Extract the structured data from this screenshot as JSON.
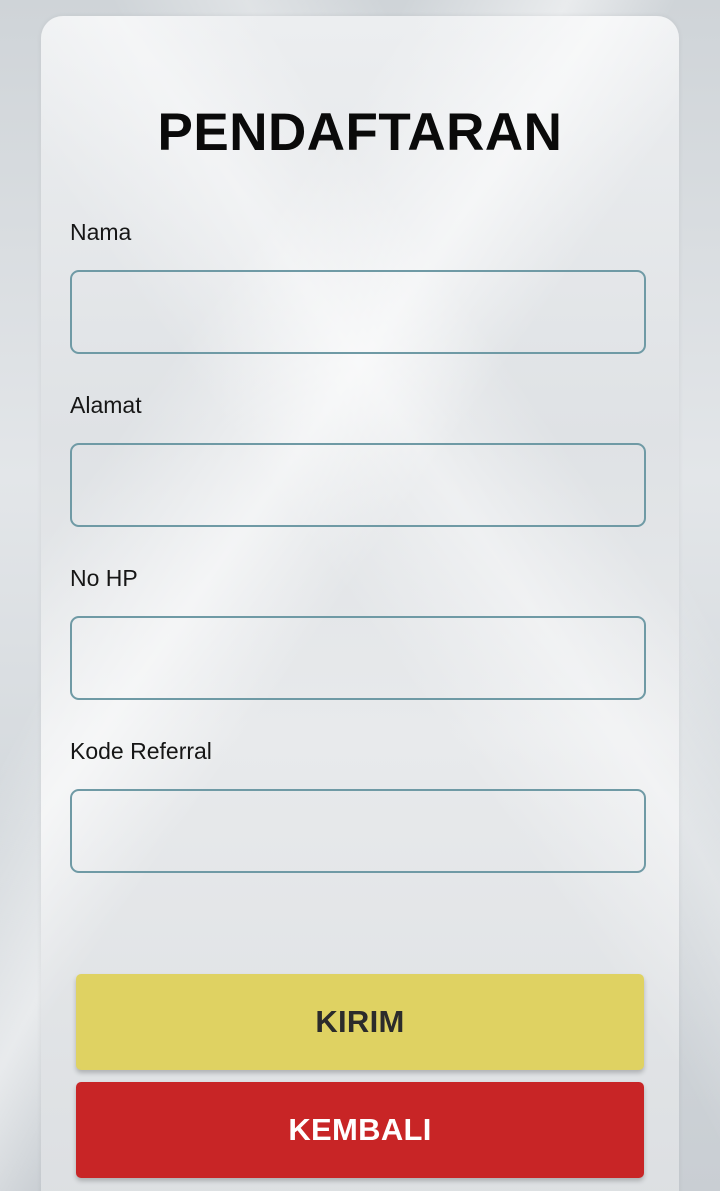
{
  "form": {
    "title": "PENDAFTARAN",
    "fields": [
      {
        "label": "Nama",
        "value": "",
        "placeholder": ""
      },
      {
        "label": "Alamat",
        "value": "",
        "placeholder": ""
      },
      {
        "label": "No HP",
        "value": "",
        "placeholder": ""
      },
      {
        "label": "Kode Referral",
        "value": "",
        "placeholder": ""
      }
    ],
    "submit_label": "KIRIM",
    "back_label": "KEMBALI"
  },
  "colors": {
    "submit_button": "#dfd262",
    "back_button": "#c82526",
    "input_border": "#6f9aa5"
  }
}
